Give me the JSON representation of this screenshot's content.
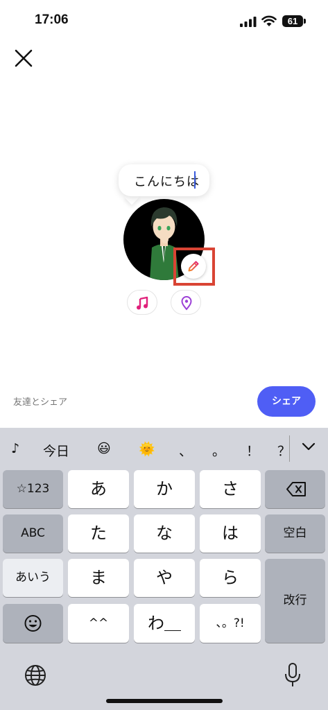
{
  "status_bar": {
    "time": "17:06",
    "battery": "61",
    "icons": [
      "signal-icon",
      "wifi-icon",
      "battery-icon"
    ]
  },
  "header": {
    "close_icon": "close-icon"
  },
  "status_message": {
    "text": "こんにちは",
    "edit_icon": "pencil-icon"
  },
  "attachments": {
    "icons": [
      "music-note-icon",
      "location-pin-icon"
    ],
    "music_color": "#e0207a",
    "location_color": "#9b3fd6"
  },
  "share_bar": {
    "label": "友達とシェア",
    "button": "シェア",
    "accent": "#4f5ef5"
  },
  "keyboard": {
    "candidates": {
      "note": "♪",
      "today": "今日",
      "emoji1": "😃",
      "emoji2": "🌞",
      "comma": "、",
      "period": "。",
      "exclaim": "！",
      "question": "？"
    },
    "keys": {
      "num_mode": "☆123",
      "abc": "ABC",
      "kana_mode": "あいう",
      "a": "あ",
      "ka": "か",
      "sa": "さ",
      "ta": "た",
      "na": "な",
      "ha": "は",
      "ma": "ま",
      "ya": "や",
      "ra": "ら",
      "dakuten": "^^",
      "wa": "わ＿",
      "punct": "、。?!",
      "space": "空白",
      "return": "改行"
    }
  }
}
